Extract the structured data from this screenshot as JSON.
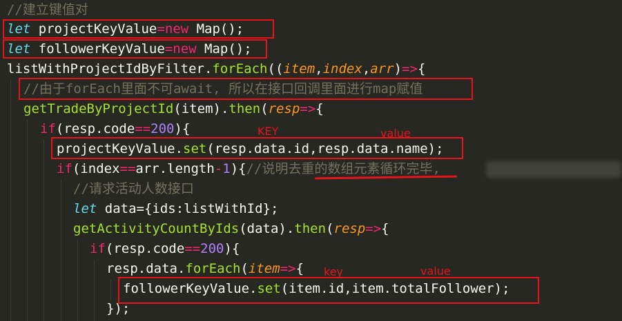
{
  "theme": {
    "background": "#272822",
    "foreground": "#f8f8f2",
    "comment": "#75715e",
    "keyword": "#f92672",
    "function": "#a6e22e",
    "number": "#ae81ff",
    "storage": "#66d9ef",
    "parameter": "#fd971f",
    "annotation": "#e8141c"
  },
  "code_lines": [
    {
      "id": "l1",
      "tokens": [
        {
          "t": "cmt",
          "v": "//建立键值对"
        }
      ]
    },
    {
      "id": "l2",
      "tokens": [
        {
          "t": "let",
          "v": "let"
        },
        {
          "t": "pl",
          "v": " projectKeyValue"
        },
        {
          "t": "kw",
          "v": "="
        },
        {
          "t": "kw",
          "v": "new"
        },
        {
          "t": "pl",
          "v": " Map();"
        }
      ]
    },
    {
      "id": "l3",
      "tokens": [
        {
          "t": "let",
          "v": "let"
        },
        {
          "t": "pl",
          "v": " followerKeyValue"
        },
        {
          "t": "kw",
          "v": "="
        },
        {
          "t": "kw",
          "v": "new"
        },
        {
          "t": "pl",
          "v": " Map();"
        }
      ]
    },
    {
      "id": "l4",
      "tokens": [
        {
          "t": "pl",
          "v": "listWithProjectIdByFilter."
        },
        {
          "t": "fn",
          "v": "forEach"
        },
        {
          "t": "pl",
          "v": "(("
        },
        {
          "t": "prm",
          "v": "item"
        },
        {
          "t": "pl",
          "v": ","
        },
        {
          "t": "prm",
          "v": "index"
        },
        {
          "t": "pl",
          "v": ","
        },
        {
          "t": "prm",
          "v": "arr"
        },
        {
          "t": "pl",
          "v": ")"
        },
        {
          "t": "kw",
          "v": "=>"
        },
        {
          "t": "pl",
          "v": "{"
        }
      ]
    },
    {
      "id": "l5",
      "tokens": [
        {
          "t": "cmt",
          "v": "//由于forEach里面不可await, 所以在接口回调里面进行map赋值"
        }
      ]
    },
    {
      "id": "l6",
      "tokens": [
        {
          "t": "fn",
          "v": "getTradeByProjectId"
        },
        {
          "t": "pl",
          "v": "(item)."
        },
        {
          "t": "fn",
          "v": "then"
        },
        {
          "t": "pl",
          "v": "("
        },
        {
          "t": "prm",
          "v": "resp"
        },
        {
          "t": "kw",
          "v": "=>"
        },
        {
          "t": "pl",
          "v": "{"
        }
      ]
    },
    {
      "id": "l7",
      "tokens": [
        {
          "t": "kw",
          "v": "if"
        },
        {
          "t": "pl",
          "v": "(resp.code"
        },
        {
          "t": "kw",
          "v": "=="
        },
        {
          "t": "num",
          "v": "200"
        },
        {
          "t": "pl",
          "v": "){"
        }
      ]
    },
    {
      "id": "l8",
      "tokens": [
        {
          "t": "pl",
          "v": "projectKeyValue."
        },
        {
          "t": "fn",
          "v": "set"
        },
        {
          "t": "pl",
          "v": "(resp.data.id,resp.data.name);"
        }
      ]
    },
    {
      "id": "l9",
      "tokens": [
        {
          "t": "kw",
          "v": "if"
        },
        {
          "t": "pl",
          "v": "(index"
        },
        {
          "t": "kw",
          "v": "=="
        },
        {
          "t": "pl",
          "v": "arr.length"
        },
        {
          "t": "kw",
          "v": "-"
        },
        {
          "t": "num",
          "v": "1"
        },
        {
          "t": "pl",
          "v": "){"
        },
        {
          "t": "cmt",
          "v": "//说明去重的数组元素循环完毕,"
        }
      ]
    },
    {
      "id": "l10",
      "tokens": [
        {
          "t": "cmt",
          "v": "//请求活动人数接口"
        }
      ]
    },
    {
      "id": "l11",
      "tokens": [
        {
          "t": "let",
          "v": "let"
        },
        {
          "t": "pl",
          "v": " data={ids:listWithId};"
        }
      ]
    },
    {
      "id": "l12",
      "tokens": [
        {
          "t": "fn",
          "v": "getActivityCountByIds"
        },
        {
          "t": "pl",
          "v": "(data)."
        },
        {
          "t": "fn",
          "v": "then"
        },
        {
          "t": "pl",
          "v": "("
        },
        {
          "t": "prm",
          "v": "resp"
        },
        {
          "t": "kw",
          "v": "=>"
        },
        {
          "t": "pl",
          "v": "{"
        }
      ]
    },
    {
      "id": "l13",
      "tokens": [
        {
          "t": "kw",
          "v": "if"
        },
        {
          "t": "pl",
          "v": "(resp.code"
        },
        {
          "t": "kw",
          "v": "=="
        },
        {
          "t": "num",
          "v": "200"
        },
        {
          "t": "pl",
          "v": "){"
        }
      ]
    },
    {
      "id": "l14",
      "tokens": [
        {
          "t": "pl",
          "v": "resp.data."
        },
        {
          "t": "fn",
          "v": "forEach"
        },
        {
          "t": "pl",
          "v": "("
        },
        {
          "t": "prm",
          "v": "item"
        },
        {
          "t": "kw",
          "v": "=>"
        },
        {
          "t": "pl",
          "v": "{"
        }
      ]
    },
    {
      "id": "l15",
      "tokens": [
        {
          "t": "pl",
          "v": "followerKeyValue."
        },
        {
          "t": "fn",
          "v": "set"
        },
        {
          "t": "pl",
          "v": "(item.id,item.totalFollower);"
        }
      ]
    },
    {
      "id": "l16",
      "tokens": [
        {
          "t": "pl",
          "v": "});"
        }
      ]
    }
  ],
  "annotations": {
    "key_upper": "KEY",
    "value_upper": "value",
    "key_lower": "key",
    "value_lower": "value"
  }
}
